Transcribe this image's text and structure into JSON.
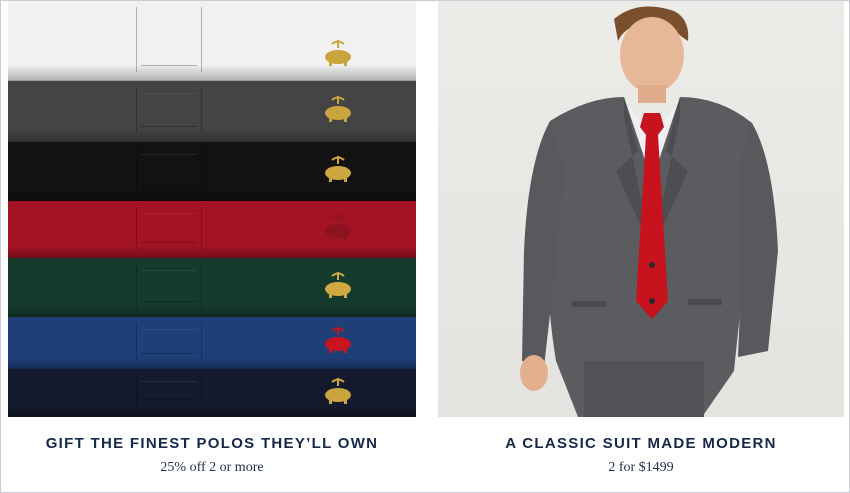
{
  "tiles": [
    {
      "headline": "GIFT THE FINEST POLOS THEY’LL OWN",
      "subline": "25% off 2 or more",
      "image_name": "folded-polo-shirts-stack",
      "polo_colors": [
        "#f1f1f1",
        "#444446",
        "#121213",
        "#a41324",
        "#153b2c",
        "#1f3f78",
        "#141a2d"
      ],
      "logo_colors": [
        "#c9a43a",
        "#caa43c",
        "#cda63f",
        "#8d1320",
        "#d0a940",
        "#c7141e",
        "#caa43c"
      ]
    },
    {
      "headline": "A CLASSIC SUIT MADE MODERN",
      "subline": "2 for $1499",
      "image_name": "man-in-grey-suit-red-tie"
    }
  ],
  "colors": {
    "headline": "#15294a",
    "border": "#c9ccd3",
    "suit": "#5b5c5f",
    "tie": "#c8121e"
  }
}
